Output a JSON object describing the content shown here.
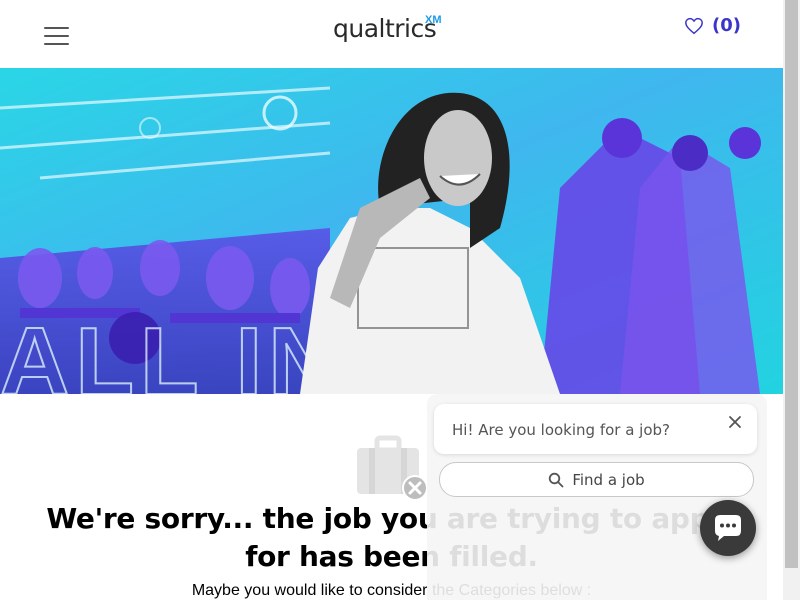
{
  "header": {
    "logo_text": "qualtrics",
    "logo_suffix": "XM",
    "favorites_count": "(0)"
  },
  "hero": {
    "overlay_text": "ALL IN"
  },
  "content": {
    "sorry_line1": "We're sorry... the job you are trying to apply",
    "sorry_line2": "for has been filled.",
    "maybe_text": "Maybe you would like to consider the Categories below :"
  },
  "chat": {
    "greeting": "Hi! Are you looking for a job?",
    "find_job_label": "Find a job"
  },
  "colors": {
    "accent": "#3b36c9",
    "hero_cyan": "#22d3e0",
    "hero_purple": "#6a3fe8",
    "logo_xm": "#1b9ae8"
  }
}
